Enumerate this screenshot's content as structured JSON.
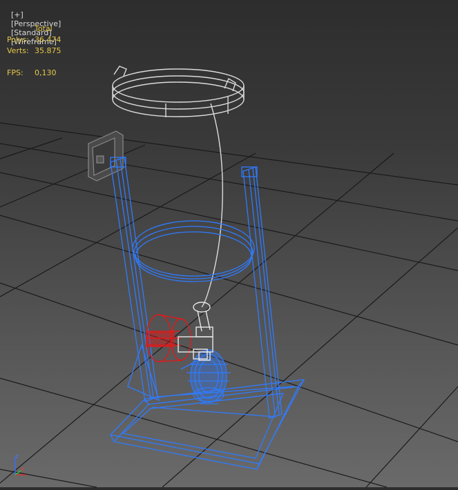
{
  "viewport": {
    "label": {
      "plus": "[+]",
      "view": "[Perspective]",
      "shading_mode": "[Standard]",
      "display": "[Wireframe]"
    },
    "stats": {
      "header": "Total",
      "polys_label": "Polys:",
      "polys_value": "36.474",
      "verts_label": "Verts:",
      "verts_value": "35.875",
      "fps_label": "FPS:",
      "fps_value": "0,130"
    },
    "axis_gizmo": {
      "z": "z",
      "x": "x"
    }
  },
  "colors": {
    "selected_wire": "#2f7bff",
    "unselected_wire": "#dcdcdc",
    "red_part": "#e01a1a",
    "grid": "#1a1a1a",
    "stats_text": "#e6c84a",
    "label_text": "#d8d8d8"
  }
}
